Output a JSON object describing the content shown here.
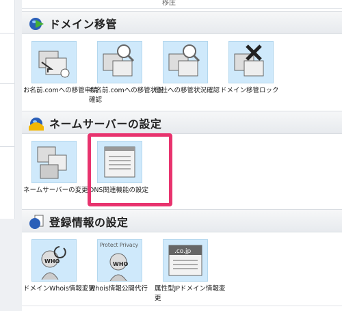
{
  "top_text": "移庄",
  "sections": [
    {
      "title": "ドメイン移管",
      "items": [
        {
          "label": "お名前.comへの移管申請",
          "icon": "transfer-request-icon"
        },
        {
          "label": "お名前.comへの移管状況確認",
          "icon": "transfer-status-icon"
        },
        {
          "label": "他社への移管状況確認",
          "icon": "transfer-out-status-icon"
        },
        {
          "label": "ドメイン移管ロック",
          "icon": "transfer-lock-icon"
        }
      ]
    },
    {
      "title": "ネームサーバーの設定",
      "items": [
        {
          "label": "ネームサーバーの変更",
          "icon": "nameserver-change-icon"
        },
        {
          "label": "DNS関連機能の設定",
          "icon": "dns-settings-icon"
        }
      ]
    },
    {
      "title": "登録情報の設定",
      "items": [
        {
          "label": "ドメインWhois情報変更",
          "icon": "whois-change-icon"
        },
        {
          "label": "Whois情報公開代行",
          "icon": "whois-privacy-icon",
          "icon_text": "Protect Privacy"
        },
        {
          "label": "属性型JPドメイン情報変更",
          "icon": "jp-domain-info-icon",
          "icon_text": ".co.jp"
        }
      ]
    }
  ]
}
